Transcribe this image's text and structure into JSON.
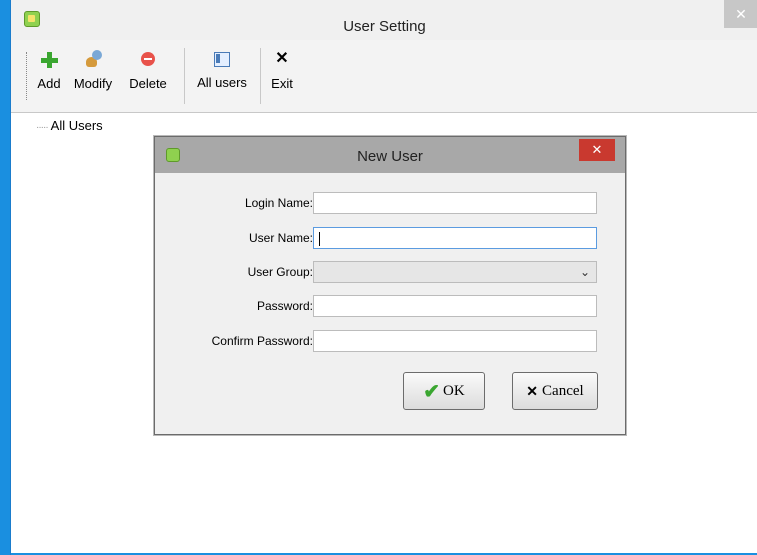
{
  "window": {
    "title": "User Setting",
    "close_glyph": "✕"
  },
  "toolbar": {
    "items": [
      {
        "label": "Add",
        "icon": "plus-icon"
      },
      {
        "label": "Modify",
        "icon": "users-edit-icon"
      },
      {
        "label": "Delete",
        "icon": "minus-circle-icon"
      },
      {
        "label": "All users",
        "icon": "list-window-icon"
      },
      {
        "label": "Exit",
        "icon": "x-icon"
      }
    ],
    "exit_glyph": "✕"
  },
  "tree": {
    "root_label": "All Users",
    "connector": "·····"
  },
  "dialog": {
    "title": "New User",
    "close_glyph": "✕",
    "fields": {
      "login_name": {
        "label": "Login Name:",
        "value": ""
      },
      "user_name": {
        "label": "User Name:",
        "value": ""
      },
      "user_group": {
        "label": "User Group:",
        "value": ""
      },
      "password": {
        "label": "Password:",
        "value": ""
      },
      "confirm_password": {
        "label": "Confirm Password:",
        "value": ""
      }
    },
    "ok_label": "OK",
    "ok_glyph": "✔",
    "cancel_label": "Cancel",
    "cancel_glyph": "✕",
    "select_chevron": "⌄"
  },
  "colors": {
    "desktop": "#1a8fe0",
    "close_red": "#c9392f",
    "add_green": "#3aa630"
  }
}
